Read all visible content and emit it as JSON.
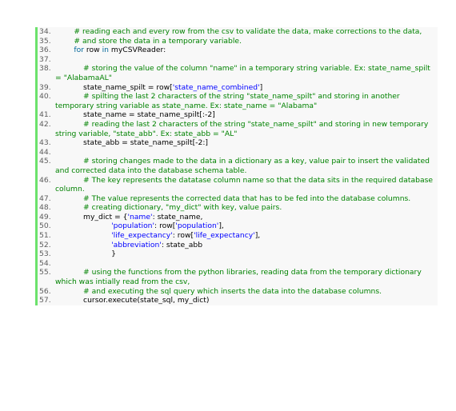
{
  "lines": [
    {
      "n": "34.",
      "segs": [
        {
          "t": "        # reading each and every row from the csv to validate the data, make corrections to the data,",
          "c": "cm"
        }
      ]
    },
    {
      "n": "35.",
      "segs": [
        {
          "t": "        # and store the data in a temporary variable.",
          "c": "cm"
        }
      ]
    },
    {
      "n": "36.",
      "segs": [
        {
          "t": "        ",
          "c": ""
        },
        {
          "t": "for",
          "c": "kw"
        },
        {
          "t": " row ",
          "c": ""
        },
        {
          "t": "in",
          "c": "kw"
        },
        {
          "t": " myCSVReader:",
          "c": ""
        }
      ]
    },
    {
      "n": "37.",
      "segs": []
    },
    {
      "n": "38.",
      "segs": [
        {
          "t": "            # storing the value of the column \"name\" in a temporary string variable. Ex: state_name_spilt = \"AlabamaAL\"",
          "c": "cm"
        }
      ]
    },
    {
      "n": "39.",
      "segs": [
        {
          "t": "            state_name_spilt = row[",
          "c": ""
        },
        {
          "t": "'state_name_combined'",
          "c": "str"
        },
        {
          "t": "]",
          "c": ""
        }
      ]
    },
    {
      "n": "40.",
      "segs": [
        {
          "t": "            # spilting the last 2 characters of the string \"state_name_spilt\" and storing in another temporary string variable as state_name. Ex: state_name = \"Alabama\"",
          "c": "cm"
        }
      ]
    },
    {
      "n": "41.",
      "segs": [
        {
          "t": "            state_name = state_name_spilt[:-2]",
          "c": ""
        }
      ]
    },
    {
      "n": "42.",
      "segs": [
        {
          "t": "            # reading the last 2 characters of the string \"state_name_spilt\" and storing in new temporary string variable, \"state_abb\". Ex: state_abb = \"AL\"",
          "c": "cm"
        }
      ]
    },
    {
      "n": "43.",
      "segs": [
        {
          "t": "            state_abb = state_name_spilt[-2:]",
          "c": ""
        }
      ]
    },
    {
      "n": "44.",
      "segs": []
    },
    {
      "n": "45.",
      "segs": [
        {
          "t": "            # storing changes made to the data in a dictionary as a key, value pair to insert the validated and corrected data into the database schema table.",
          "c": "cm"
        }
      ]
    },
    {
      "n": "46.",
      "segs": [
        {
          "t": "            # The key represents the datatase column name so that the data sits in the required database column.",
          "c": "cm"
        }
      ]
    },
    {
      "n": "47.",
      "segs": [
        {
          "t": "            # The value represents the corrected data that has to be fed into the database columns.",
          "c": "cm"
        }
      ]
    },
    {
      "n": "48.",
      "segs": [
        {
          "t": "            # creating dictionary, \"my_dict\" with key, value pairs.",
          "c": "cm"
        }
      ]
    },
    {
      "n": "49.",
      "segs": [
        {
          "t": "            my_dict = {",
          "c": ""
        },
        {
          "t": "'name'",
          "c": "str"
        },
        {
          "t": ": state_name,",
          "c": ""
        }
      ]
    },
    {
      "n": "50.",
      "segs": [
        {
          "t": "                        ",
          "c": ""
        },
        {
          "t": "'population'",
          "c": "str"
        },
        {
          "t": ": row[",
          "c": ""
        },
        {
          "t": "'population'",
          "c": "str"
        },
        {
          "t": "],",
          "c": ""
        }
      ]
    },
    {
      "n": "51.",
      "segs": [
        {
          "t": "                        ",
          "c": ""
        },
        {
          "t": "'life_expectancy'",
          "c": "str"
        },
        {
          "t": ": row[",
          "c": ""
        },
        {
          "t": "'life_expectancy'",
          "c": "str"
        },
        {
          "t": "],",
          "c": ""
        }
      ]
    },
    {
      "n": "52.",
      "segs": [
        {
          "t": "                        ",
          "c": ""
        },
        {
          "t": "'abbreviation'",
          "c": "str"
        },
        {
          "t": ": state_abb",
          "c": ""
        }
      ]
    },
    {
      "n": "53.",
      "segs": [
        {
          "t": "                        }",
          "c": ""
        }
      ]
    },
    {
      "n": "54.",
      "segs": []
    },
    {
      "n": "55.",
      "segs": [
        {
          "t": "            # using the functions from the python libraries, reading data from the temporary dictionary which was intially read from the csv,",
          "c": "cm"
        }
      ]
    },
    {
      "n": "56.",
      "segs": [
        {
          "t": "            # and executing the sql query which inserts the data into the database columns.",
          "c": "cm"
        }
      ]
    },
    {
      "n": "57.",
      "segs": [
        {
          "t": "            cursor.execute(state_sql, my_dict)",
          "c": ""
        }
      ]
    }
  ]
}
